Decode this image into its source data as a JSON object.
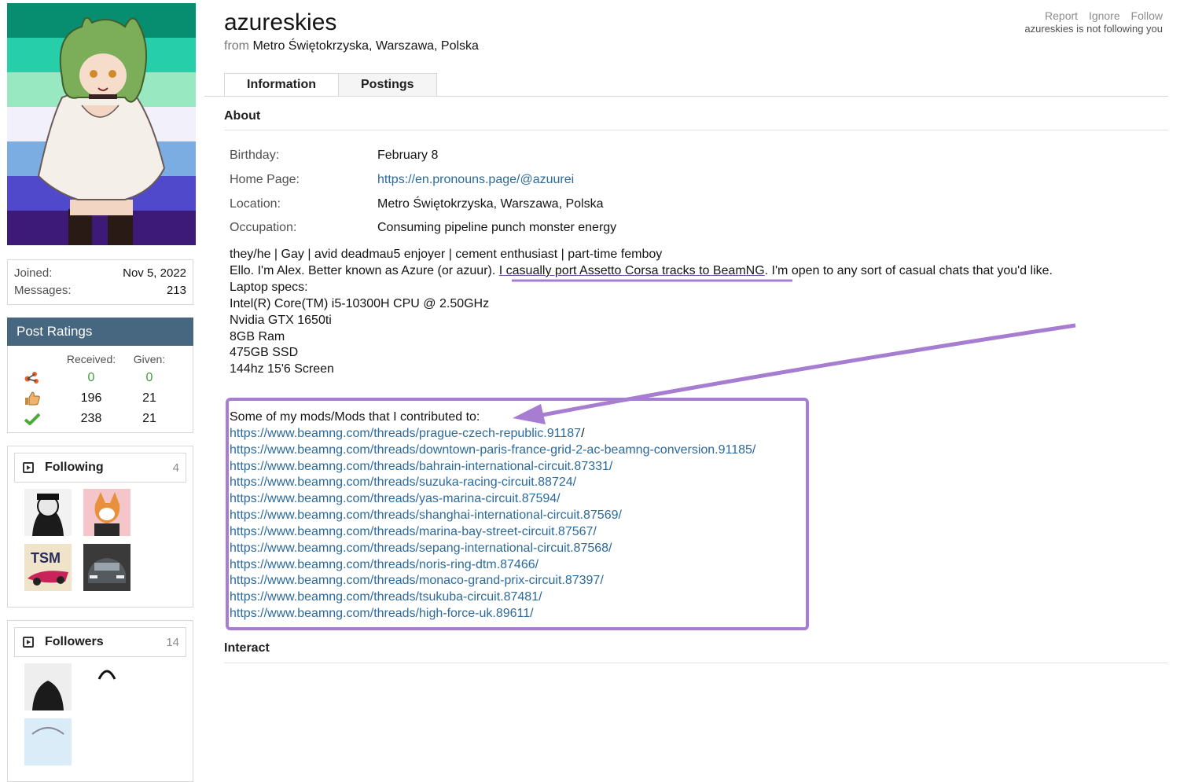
{
  "profile": {
    "username": "azureskies",
    "from_label": "from",
    "location": "Metro Świętokrzyska, Warszawa, Polska"
  },
  "actions": {
    "report": "Report",
    "ignore": "Ignore",
    "follow": "Follow",
    "follow_note": "azureskies is not following you"
  },
  "stats": {
    "joined_label": "Joined:",
    "joined_value": "Nov 5, 2022",
    "messages_label": "Messages:",
    "messages_value": "213"
  },
  "ratings": {
    "title": "Post Ratings",
    "received_label": "Received:",
    "given_label": "Given:",
    "rows": [
      {
        "icon": "rating-network-icon",
        "received": "0",
        "given": "0"
      },
      {
        "icon": "thumbs-up-icon",
        "received": "196",
        "given": "21"
      },
      {
        "icon": "checkmark-icon",
        "received": "238",
        "given": "21"
      }
    ]
  },
  "following": {
    "title": "Following",
    "count": "4"
  },
  "followers": {
    "title": "Followers",
    "count": "14"
  },
  "tabs": [
    {
      "label": "Information",
      "active": true
    },
    {
      "label": "Postings",
      "active": false
    }
  ],
  "about": {
    "heading": "About",
    "fields": [
      {
        "key": "Birthday:",
        "value": "February 8"
      },
      {
        "key": "Home Page:",
        "value": "https://en.pronouns.page/@azuurei"
      },
      {
        "key": "Location:",
        "value": "Metro Świętokrzyska, Warszawa, Polska"
      },
      {
        "key": "Occupation:",
        "value": "Consuming pipeline punch monster energy"
      }
    ],
    "bio_line1": "they/he | Gay | avid deadmau5 enjoyer | cement enthusiast | part-time femboy",
    "bio_line2_pre": "Ello. I'm Alex. Better known as Azure (or azuur). ",
    "bio_line2_highlight": "I casually port Assetto Corsa tracks to BeamNG",
    "bio_line2_post": ". I'm open to any sort of casual chats that you'd like.",
    "specs": [
      "Laptop specs:",
      "Intel(R) Core(TM) i5-10300H CPU @ 2.50GHz",
      "Nvidia GTX 1650ti",
      "8GB Ram",
      "475GB SSD",
      "144hz 15'6 Screen"
    ],
    "mods_intro": "Some of my mods/Mods that I contributed to:",
    "first_link": "https://www.beamng.com/threads/prague-czech-republic.91187",
    "first_link_suffix": "/",
    "mod_links": [
      "https://www.beamng.com/threads/downtown-paris-france-grid-2-ac-beamng-conversion.91185/",
      "https://www.beamng.com/threads/bahrain-international-circuit.87331/",
      "https://www.beamng.com/threads/suzuka-racing-circuit.88724/",
      "https://www.beamng.com/threads/yas-marina-circuit.87594/",
      "https://www.beamng.com/threads/shanghai-international-circuit.87569/",
      "https://www.beamng.com/threads/marina-bay-street-circuit.87567/",
      "https://www.beamng.com/threads/sepang-international-circuit.87568/",
      "https://www.beamng.com/threads/noris-ring-dtm.87466/",
      "https://www.beamng.com/threads/monaco-grand-prix-circuit.87397/",
      "https://www.beamng.com/threads/tsukuba-circuit.87481/",
      "https://www.beamng.com/threads/high-force-uk.89611/"
    ]
  },
  "interact": {
    "heading": "Interact"
  },
  "colors": {
    "link": "#2b6a9c",
    "ratings_header": "#47667f",
    "annotation_purple": "#a67dd0"
  }
}
